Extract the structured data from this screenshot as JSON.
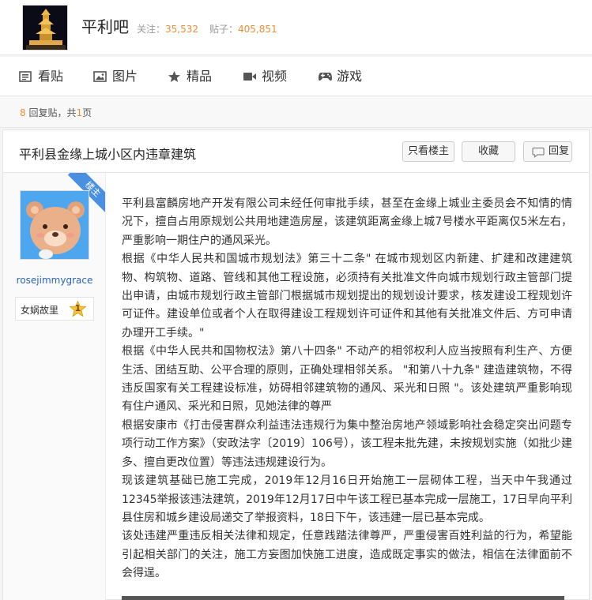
{
  "forum": {
    "name": "平利吧",
    "follow_label": "关注：",
    "follow_count": "35,532",
    "posts_label": "贴子：",
    "posts_count": "405,851"
  },
  "nav": [
    {
      "icon": "list-icon",
      "label": "看贴"
    },
    {
      "icon": "image-icon",
      "label": "图片"
    },
    {
      "icon": "star-icon",
      "label": "精品"
    },
    {
      "icon": "video-icon",
      "label": "视频"
    },
    {
      "icon": "gamepad-icon",
      "label": "游戏"
    }
  ],
  "pager": {
    "reply_count": "8",
    "reply_text": " 回复贴，共",
    "page_count": "1",
    "page_suffix": "页"
  },
  "thread": {
    "title": "平利县金缘上城小区内违章建筑",
    "only_op_label": "只看楼主",
    "favorite_label": "收藏",
    "reply_label": "回复"
  },
  "post": {
    "floor_tag": "楼主",
    "username": "rosejimmygrace",
    "badge_name": "女娲故里",
    "badge_level": "1",
    "paragraphs": [
      "平利县富麟房地产开发有限公司未经任何审批手续，甚至在金缘上城业主委员会不知情的情况下，擅自占用原规划公共用地建造房屋，该建筑距离金缘上城7号楼水平距离仅5米左右，严重影响一期住户的通风采光。",
      "根据《中华人民共和国城市规划法》第三十二条\" 在城市规划区内新建、扩建和改建建筑物、构筑物、道路、管线和其他工程设施，必须持有关批准文件向城市规划行政主管部门提出申请，由城市规划行政主管部门根据城市规划提出的规划设计要求，核发建设工程规划许可证件。建设单位或者个人在取得建设工程规划许可证件和其他有关批准文件后、方可申请办理开工手续。\"",
      "根据《中华人民共和国物权法》第八十四条\" 不动产的相邻权利人应当按照有利生产、方便生活、团结互助、公平合理的原则，正确处理相邻关系。 \"和第八十九条\" 建造建筑物，不得违反国家有关工程建设标准，妨碍相邻建筑物的通风、采光和日照 \"。该处建筑严重影响现有住户通风、采光和日照，见她法律的尊严",
      "根据安康市《打击侵害群众利益违法违规行为集中整治房地产领域影响社会稳定突出问题专项行动工作方案》（安政法字〔2019〕106号），该工程未批先建，未按规划实施（如批少建多、擅自更改位置）等违法违规建设行为。",
      "现该建筑基础已施工完成，2019年12月16日开始施工一层砌体工程，当天中午我通过12345举报该违法建筑，2019年12月17日中午该工程已基本完成一层施工，17日早向平利县住房和城乡建设局递交了举报资料，18日下午，该违建一层已基本完成。",
      "该处违建严重违反相关法律和规定，任意践踏法律尊严，严重侵害百姓利益的行为，希望能引起相关部门的关注，施工方妄图加快施工进度，造成既定事实的做法，相信在法律面前不会得逞。"
    ]
  },
  "colors": {
    "accent_orange": "#f08c35",
    "link_blue": "#2d64b3",
    "ribbon_blue": "#4a90e2"
  }
}
